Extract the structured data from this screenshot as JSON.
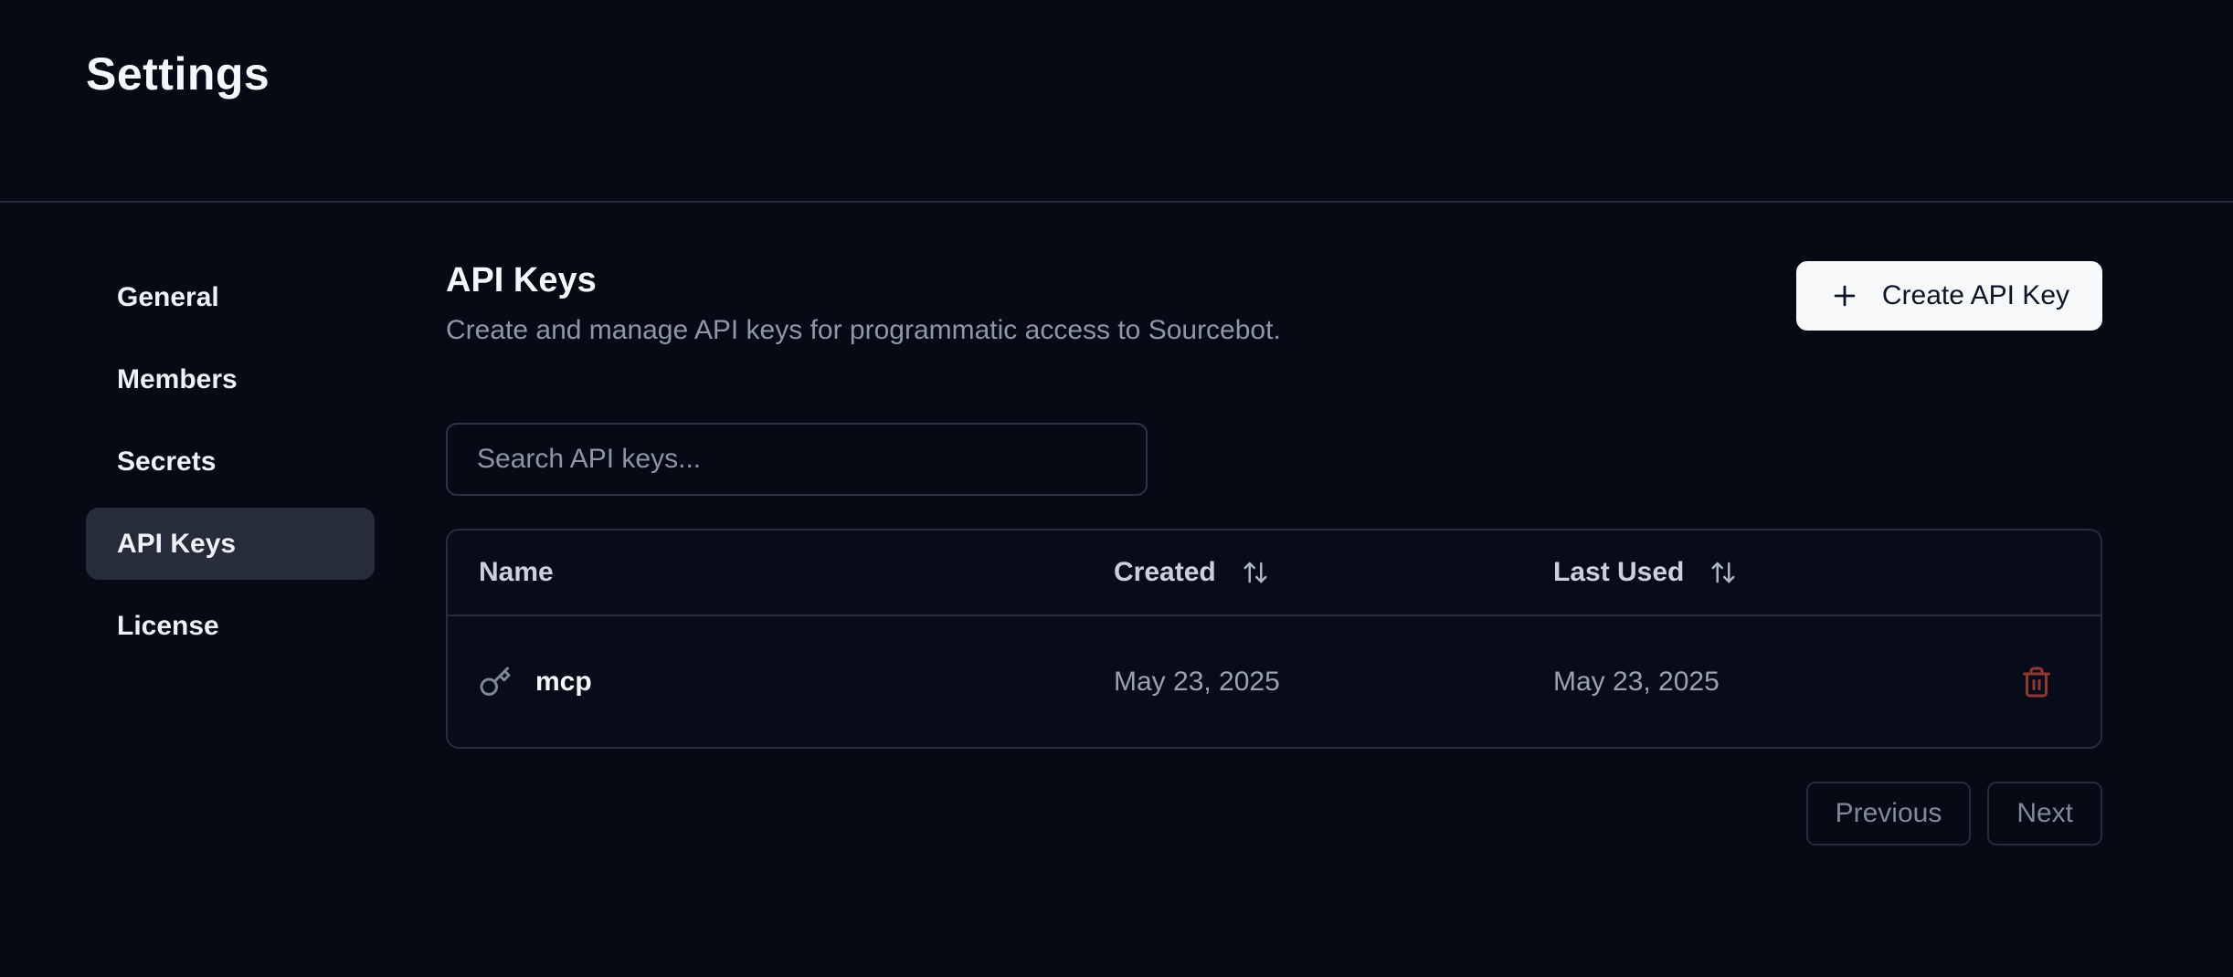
{
  "page": {
    "title": "Settings"
  },
  "sidebar": {
    "items": [
      {
        "label": "General",
        "active": false
      },
      {
        "label": "Members",
        "active": false
      },
      {
        "label": "Secrets",
        "active": false
      },
      {
        "label": "API Keys",
        "active": true
      },
      {
        "label": "License",
        "active": false
      }
    ]
  },
  "main": {
    "heading": "API Keys",
    "description": "Create and manage API keys for programmatic access to Sourcebot.",
    "create_button": {
      "label": "Create API Key",
      "icon": "plus-icon"
    },
    "search": {
      "placeholder": "Search API keys...",
      "value": ""
    },
    "table": {
      "columns": [
        {
          "label": "Name",
          "sortable": false
        },
        {
          "label": "Created",
          "sortable": true,
          "icon": "sort-arrows-icon"
        },
        {
          "label": "Last Used",
          "sortable": true,
          "icon": "sort-arrows-icon"
        }
      ],
      "rows": [
        {
          "icon": "key-icon",
          "name": "mcp",
          "created": "May 23, 2025",
          "last_used": "May 23, 2025",
          "action_icon": "trash-icon"
        }
      ]
    },
    "pagination": {
      "previous_label": "Previous",
      "next_label": "Next"
    }
  },
  "colors": {
    "background": "#060a15",
    "divider": "#232a38",
    "sidebar_active_bg": "#262c3a",
    "card_border": "#262d3c",
    "primary_button_bg": "#f7f9fb",
    "primary_button_text": "#0d1424",
    "muted_text": "#8e96a8",
    "danger_icon": "#8e3a33"
  }
}
